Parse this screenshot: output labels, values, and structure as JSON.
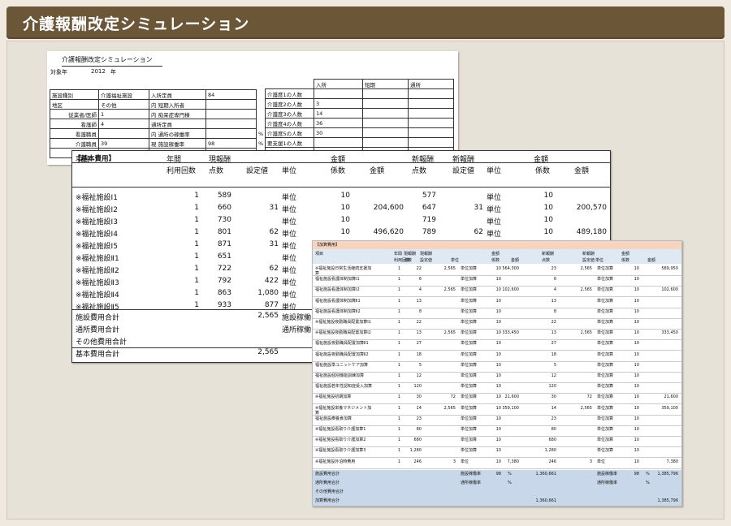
{
  "header": {
    "title": "介護報酬改定シミュレーション"
  },
  "colors": {
    "header_bg": "#6b5638",
    "frame_bg": "#e7e2d8",
    "addon_header": "#f6d4c0",
    "addon_footer": "#c8d8ea"
  },
  "sheet1": {
    "title": "介護報酬改定シミュレーション",
    "year_label": "対象年",
    "year": "2012",
    "year_unit": "年",
    "left_rows": [
      [
        "施設種別",
        "介護福祉施設",
        "入所定員",
        "84",
        ""
      ],
      [
        "地区",
        "その他",
        "内 短期入所者",
        "",
        ""
      ],
      [
        "従業者/医師",
        "1",
        "内 痴呆症専門棟",
        "",
        ""
      ],
      [
        "看護師",
        "4",
        "通所定員",
        "",
        ""
      ],
      [
        "看護職員",
        "",
        "内 通所の稼働率",
        "",
        "%"
      ],
      [
        "介護職員",
        "39",
        "現 施設稼働率",
        "98",
        "%"
      ],
      [
        "",
        "",
        "",
        "",
        ""
      ]
    ],
    "right_header": [
      "",
      "入所",
      "短期",
      "通所"
    ],
    "right_rows": [
      [
        "介護度1の人数",
        "",
        "",
        ""
      ],
      [
        "介護度2の人数",
        "3",
        "",
        ""
      ],
      [
        "介護度3の人数",
        "14",
        "",
        ""
      ],
      [
        "介護度4の人数",
        "36",
        "",
        ""
      ],
      [
        "介護度5の人数",
        "30",
        "",
        ""
      ],
      [
        "要支援1の人数",
        "",
        "",
        ""
      ],
      [
        "",
        "",
        "",
        ""
      ]
    ]
  },
  "sheet2": {
    "section": "【基本費用】",
    "headers": {
      "item": "項目",
      "period": "年間",
      "usage": "利用回数",
      "cur": "現報酬",
      "cur_pts": "点数",
      "cur_set": "設定値",
      "unit": "単位",
      "amount": "金額",
      "coef": "係数",
      "amt": "金額",
      "new": "新報酬",
      "new_pts": "点数",
      "new2": "新報酬",
      "new_set": "設定値",
      "unit2": "単位",
      "amount2": "金額",
      "coef2": "係数",
      "amt2": "金額"
    },
    "rows": [
      [
        "※福祉施設Ⅰ1",
        "1",
        "589",
        "",
        "単位",
        "10",
        "",
        "577",
        "",
        "単位",
        "10",
        ""
      ],
      [
        "※福祉施設Ⅰ2",
        "1",
        "660",
        "31",
        "単位",
        "10",
        "204,600",
        "647",
        "31",
        "単位",
        "10",
        "200,570"
      ],
      [
        "※福祉施設Ⅰ3",
        "1",
        "730",
        "",
        "単位",
        "10",
        "",
        "719",
        "",
        "単位",
        "10",
        ""
      ],
      [
        "※福祉施設Ⅰ4",
        "1",
        "801",
        "62",
        "単位",
        "10",
        "496,620",
        "789",
        "62",
        "単位",
        "10",
        "489,180"
      ],
      [
        "※福祉施設Ⅰ5",
        "1",
        "871",
        "31",
        "単位",
        "",
        "",
        "",
        "",
        "",
        "",
        ""
      ],
      [
        "※福祉施設Ⅱ1",
        "1",
        "651",
        "",
        "単位",
        "",
        "",
        "",
        "",
        "",
        "",
        ""
      ],
      [
        "※福祉施設Ⅱ2",
        "1",
        "722",
        "62",
        "単位",
        "",
        "",
        "",
        "",
        "",
        "",
        ""
      ],
      [
        "※福祉施設Ⅱ3",
        "1",
        "792",
        "422",
        "単位",
        "",
        "",
        "",
        "",
        "",
        "",
        ""
      ],
      [
        "※福祉施設Ⅱ4",
        "1",
        "863",
        "1,080",
        "単位",
        "",
        "",
        "",
        "",
        "",
        "",
        ""
      ],
      [
        "※福祉施設Ⅱ5",
        "1",
        "933",
        "877",
        "単位",
        "",
        "",
        "",
        "",
        "",
        "",
        ""
      ]
    ],
    "totals": [
      {
        "label": "施設費用合計",
        "value": "2,565",
        "tail": "施設稼働"
      },
      {
        "label": "通所費用合計",
        "value": "",
        "tail": "通所稼働"
      },
      {
        "label": "その他費用合計",
        "value": "",
        "tail": ""
      },
      {
        "label": "基本費用合計",
        "value": "2,565",
        "tail": ""
      }
    ]
  },
  "sheet3": {
    "section": "【加算費用】",
    "headers": [
      "項目",
      "年間",
      "現報酬",
      "現報酬",
      "",
      "金額",
      "",
      "新報酬",
      "新報酬",
      "",
      "金額",
      ""
    ],
    "subheaders": [
      "",
      "利用回数",
      "点数",
      "設定値",
      "単位",
      "係数",
      "金額",
      "点数",
      "設定値",
      "単位",
      "係数",
      "金額"
    ],
    "rows": [
      [
        "※福祉施設日常生活継続支援加算",
        "1",
        "22",
        "2,565",
        "単位加算",
        "10",
        "564,300",
        "23",
        "2,565",
        "単位加算",
        "10",
        "589,950"
      ],
      [
        "福祉施設看護体制加算Ⅰ1",
        "1",
        "6",
        "",
        "単位加算",
        "10",
        "",
        "6",
        "",
        "単位加算",
        "10",
        ""
      ],
      [
        "福祉施設看護体制加算Ⅰ2",
        "1",
        "4",
        "2,565",
        "単位加算",
        "10",
        "102,600",
        "4",
        "2,565",
        "単位加算",
        "10",
        "102,600"
      ],
      [
        "福祉施設看護体制加算Ⅱ1",
        "1",
        "13",
        "",
        "単位加算",
        "10",
        "",
        "13",
        "",
        "単位加算",
        "10",
        ""
      ],
      [
        "福祉施設看護体制加算Ⅱ2",
        "1",
        "8",
        "",
        "単位加算",
        "10",
        "",
        "8",
        "",
        "単位加算",
        "10",
        ""
      ],
      [
        "※福祉施設夜勤職員配置加算Ⅰ1",
        "1",
        "22",
        "",
        "単位加算",
        "10",
        "",
        "22",
        "",
        "単位加算",
        "10",
        ""
      ],
      [
        "※福祉施設夜勤職員配置加算Ⅰ2",
        "1",
        "13",
        "2,565",
        "単位加算",
        "10",
        "333,450",
        "13",
        "2,565",
        "単位加算",
        "10",
        "333,450"
      ],
      [
        "福祉施設夜勤職員配置加算Ⅱ1",
        "1",
        "27",
        "",
        "単位加算",
        "10",
        "",
        "27",
        "",
        "単位加算",
        "10",
        ""
      ],
      [
        "福祉施設夜勤職員配置加算Ⅱ2",
        "1",
        "18",
        "",
        "単位加算",
        "10",
        "",
        "18",
        "",
        "単位加算",
        "10",
        ""
      ],
      [
        "福祉施設準ユニットケア加算",
        "1",
        "5",
        "",
        "単位加算",
        "10",
        "",
        "5",
        "",
        "単位加算",
        "10",
        ""
      ],
      [
        "福祉施設個別機能訓練加算",
        "1",
        "12",
        "",
        "単位加算",
        "10",
        "",
        "12",
        "",
        "単位加算",
        "10",
        ""
      ],
      [
        "福祉施設若年性認知症受入加算",
        "1",
        "120",
        "",
        "単位加算",
        "10",
        "",
        "120",
        "",
        "単位加算",
        "10",
        ""
      ],
      [
        "※福祉施設初期加算",
        "1",
        "30",
        "72",
        "単位加算",
        "10",
        "21,600",
        "30",
        "72",
        "単位加算",
        "10",
        "21,600"
      ],
      [
        "※福祉施設栄養マネジメント加算",
        "1",
        "14",
        "2,565",
        "単位加算",
        "10",
        "359,100",
        "14",
        "2,565",
        "単位加算",
        "10",
        "359,100"
      ],
      [
        "福祉施設療養食加算",
        "1",
        "23",
        "",
        "単位加算",
        "10",
        "",
        "23",
        "",
        "単位加算",
        "10",
        ""
      ],
      [
        "※福祉施設看取り介護加算1",
        "1",
        "80",
        "",
        "単位加算",
        "10",
        "",
        "80",
        "",
        "単位加算",
        "10",
        ""
      ],
      [
        "※福祉施設看取り介護加算2",
        "1",
        "680",
        "",
        "単位加算",
        "10",
        "",
        "680",
        "",
        "単位加算",
        "10",
        ""
      ],
      [
        "※福祉施設看取り介護加算3",
        "1",
        "1,280",
        "",
        "単位加算",
        "10",
        "",
        "1,280",
        "",
        "単位加算",
        "10",
        ""
      ],
      [
        "※福祉施設外泊時費用",
        "1",
        "246",
        "3",
        "単位",
        "10",
        "7,380",
        "246",
        "3",
        "単位",
        "10",
        "7,380"
      ]
    ],
    "totals": [
      [
        "施設費用合計",
        "施設稼働率",
        "98",
        "%",
        "1,360,661",
        "施設稼働率",
        "98",
        "%",
        "1,385,796"
      ],
      [
        "通所費用合計",
        "通所稼働率",
        "",
        "%",
        "",
        "通所稼働率",
        "",
        "%",
        ""
      ],
      [
        "その他費用合計",
        "",
        "",
        "",
        "",
        "",
        "",
        "",
        ""
      ],
      [
        "加算費用合計",
        "",
        "",
        "",
        "1,360,661",
        "",
        "",
        "",
        "1,385,796"
      ]
    ]
  }
}
